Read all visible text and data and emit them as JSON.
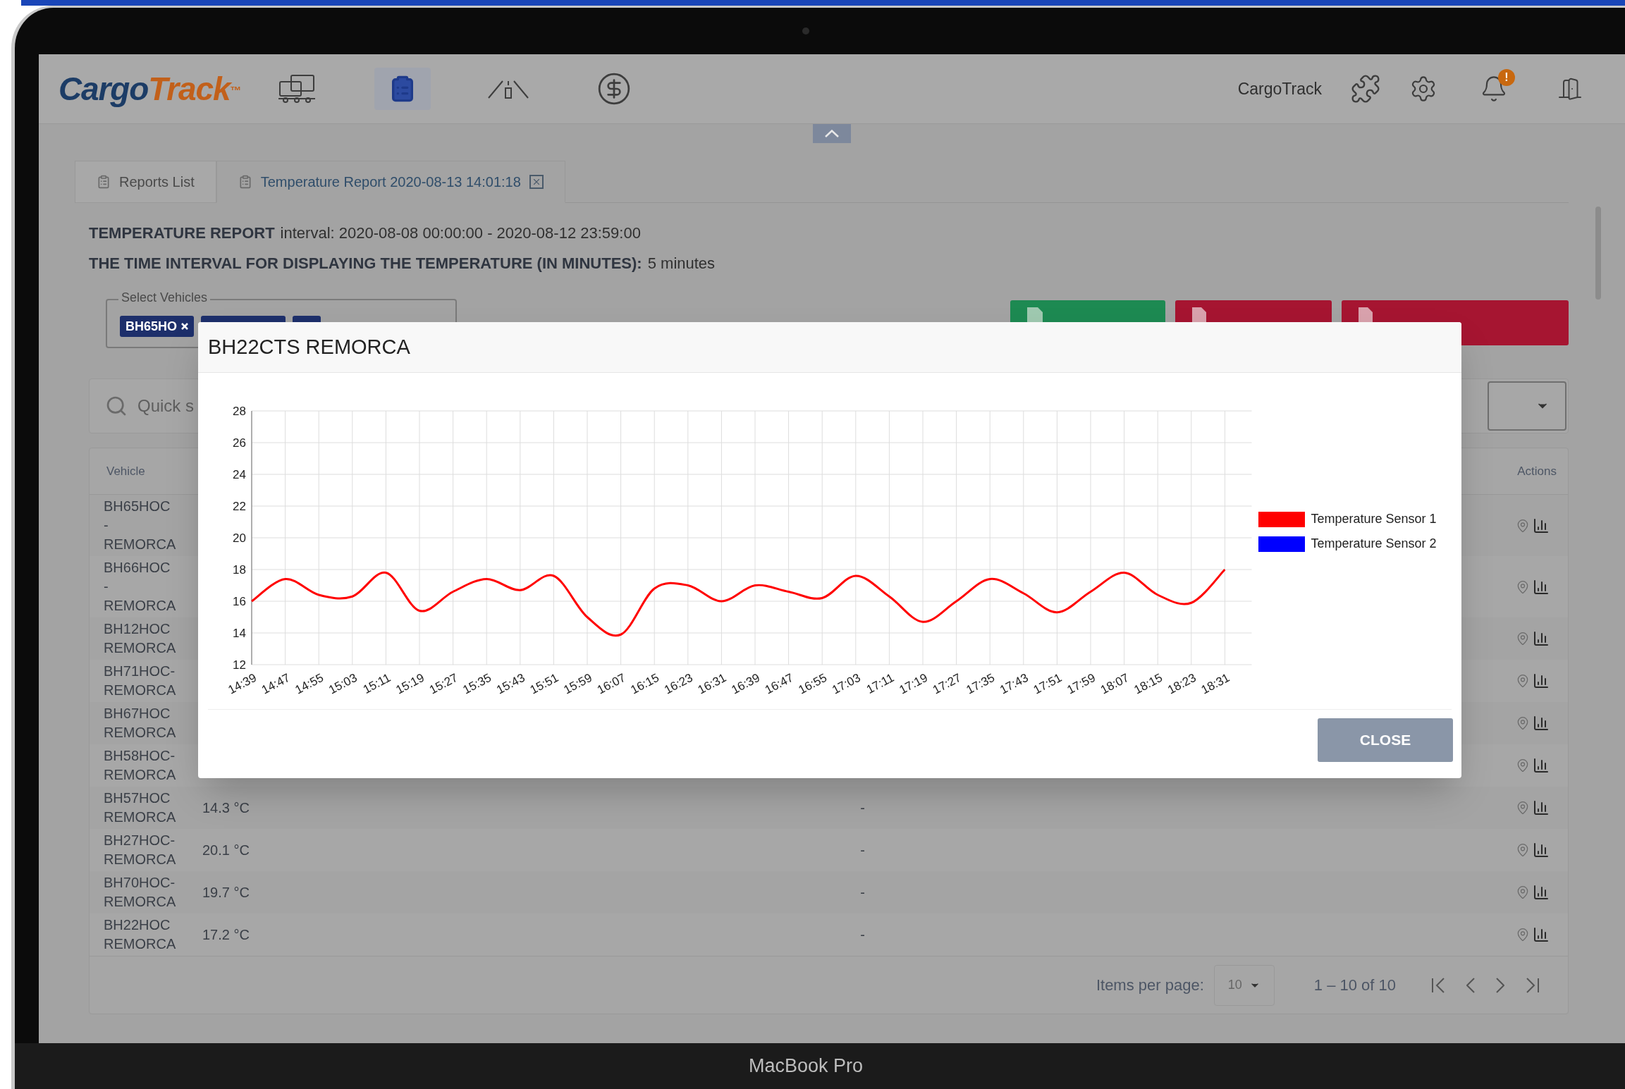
{
  "device": {
    "label": "MacBook Pro"
  },
  "header": {
    "logo": {
      "first": "Cargo",
      "second": "Track",
      "mark": "™"
    },
    "nav": [
      {
        "kind": "fleet",
        "selected": false
      },
      {
        "kind": "reports",
        "selected": true
      },
      {
        "kind": "road",
        "selected": false
      },
      {
        "kind": "billing",
        "selected": false
      }
    ],
    "company": "CargoTrack",
    "notification_badge": "!"
  },
  "tabs": [
    {
      "label": "Reports List",
      "selected": false,
      "closable": false
    },
    {
      "label": "Temperature Report 2020-08-13 14:01:18",
      "selected": true,
      "closable": true
    }
  ],
  "report": {
    "title": "TEMPERATURE REPORT",
    "interval": "interval: 2020-08-08 00:00:00 - 2020-08-12 23:59:00",
    "interval_label": "THE TIME INTERVAL FOR DISPLAYING THE TEMPERATURE (IN MINUTES):",
    "interval_value": "5 minutes"
  },
  "vehicle_select": {
    "legend": "Select Vehicles",
    "chips": [
      {
        "label": "BH65HO",
        "covered": false
      },
      {
        "covered": true
      },
      {
        "covered": true
      }
    ]
  },
  "export_buttons": [
    {
      "kind": "xls"
    },
    {
      "kind": "pdf"
    },
    {
      "kind": "custom_pdf"
    }
  ],
  "search": {
    "placeholder": "Quick s"
  },
  "table": {
    "columns": [
      "Vehicle",
      "Actions"
    ],
    "rows": [
      {
        "vehicle": [
          "BH65HOC",
          "-",
          "REMORCA"
        ]
      },
      {
        "vehicle": [
          "BH66HOC",
          "-",
          "REMORCA"
        ]
      },
      {
        "vehicle": [
          "BH12HOC",
          "REMORCA"
        ]
      },
      {
        "vehicle": [
          "BH71HOC-",
          "REMORCA"
        ]
      },
      {
        "vehicle": [
          "BH67HOC",
          "REMORCA"
        ]
      },
      {
        "vehicle": [
          "BH58HOC-",
          "REMORCA"
        ]
      },
      {
        "vehicle": [
          "BH57HOC",
          "REMORCA"
        ],
        "temperature": "14.3 °C",
        "column_3": "-"
      },
      {
        "vehicle": [
          "BH27HOC-",
          "REMORCA"
        ],
        "temperature": "20.1 °C",
        "column_3": "-"
      },
      {
        "vehicle": [
          "BH70HOC-",
          "REMORCA"
        ],
        "temperature": "19.7 °C",
        "column_3": "-"
      },
      {
        "vehicle": [
          "BH22HOC",
          "REMORCA"
        ],
        "temperature": "17.2 °C",
        "column_3": "-"
      }
    ]
  },
  "pagination": {
    "items_per_page_label": "Items per page:",
    "page_size": "10",
    "range": "1 – 10 of 10"
  },
  "modal": {
    "title": "BH22CTS REMORCA",
    "close_button": "CLOSE",
    "chart_data": {
      "type": "line",
      "grid": true,
      "categories": [
        "14:39",
        "14:47",
        "14:55",
        "15:03",
        "15:11",
        "15:19",
        "15:27",
        "15:35",
        "15:43",
        "15:51",
        "15:59",
        "16:07",
        "16:15",
        "16:23",
        "16:31",
        "16:39",
        "16:47",
        "16:55",
        "17:03",
        "17:11",
        "17:19",
        "17:27",
        "17:35",
        "17:43",
        "17:51",
        "17:59",
        "18:07",
        "18:15",
        "18:23",
        "18:31"
      ],
      "series": [
        {
          "name": "Temperature Sensor 1",
          "color": "#ff0000",
          "values": [
            16.0,
            17.4,
            16.4,
            16.3,
            17.8,
            15.4,
            16.6,
            17.4,
            16.7,
            17.6,
            15.0,
            13.9,
            16.8,
            17.0,
            16.0,
            17.0,
            16.6,
            16.2,
            17.6,
            16.3,
            14.7,
            16.0,
            17.4,
            16.5,
            15.3,
            16.6,
            17.8,
            16.4,
            15.9,
            18.0
          ]
        },
        {
          "name": "Temperature Sensor 2",
          "color": "#0000ff",
          "values": [
            null,
            null,
            null,
            null,
            null,
            null,
            null,
            null,
            null,
            null,
            null,
            null,
            null,
            null,
            null,
            null,
            null,
            null,
            null,
            null,
            null,
            null,
            null,
            null,
            null,
            null,
            null,
            null,
            null,
            null
          ]
        }
      ],
      "ylim": [
        12,
        28
      ],
      "yticks": [
        12,
        14,
        16,
        18,
        20,
        22,
        24,
        26,
        28
      ]
    }
  }
}
